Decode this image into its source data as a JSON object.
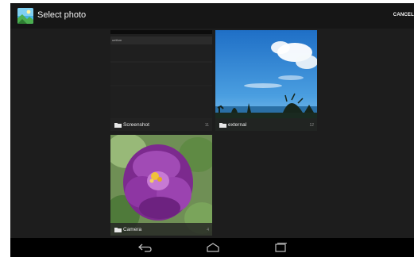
{
  "action_bar": {
    "title": "Select photo",
    "cancel_label": "CANCEL",
    "icon": "gallery-app-icon"
  },
  "albums": [
    {
      "name": "Screenshot",
      "count": "11",
      "thumbnail": "screenshot",
      "inner_text": "uetfom"
    },
    {
      "name": "external",
      "count": "12",
      "thumbnail": "sky-landscape"
    },
    {
      "name": "Camera",
      "count": "4",
      "thumbnail": "purple-flower"
    }
  ],
  "nav_bar": {
    "icons": [
      "back-icon",
      "home-icon",
      "recent-apps-icon"
    ]
  },
  "colors": {
    "background": "#1d1d1d",
    "action_bar": "#161616",
    "nav_bar": "#000000",
    "label_bar": "#232323"
  }
}
